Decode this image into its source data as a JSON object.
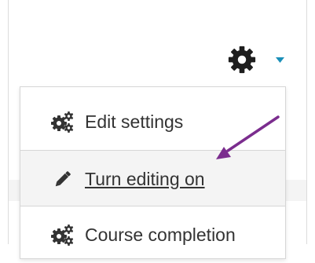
{
  "colors": {
    "caret": "#1a8fb8",
    "annotation_arrow": "#7b2d8e",
    "menu_text": "#333333",
    "highlight_row": "#f4f4f4"
  },
  "header": {
    "settings_icon": "gear-icon",
    "dropdown_icon": "caret-down-icon"
  },
  "menu": {
    "items": [
      {
        "label": "Edit settings",
        "icon": "cogs-icon"
      },
      {
        "label": "Turn editing on",
        "icon": "pencil-icon"
      },
      {
        "label": "Course completion",
        "icon": "cogs-icon"
      }
    ]
  },
  "annotation": {
    "icon": "arrow-icon"
  }
}
